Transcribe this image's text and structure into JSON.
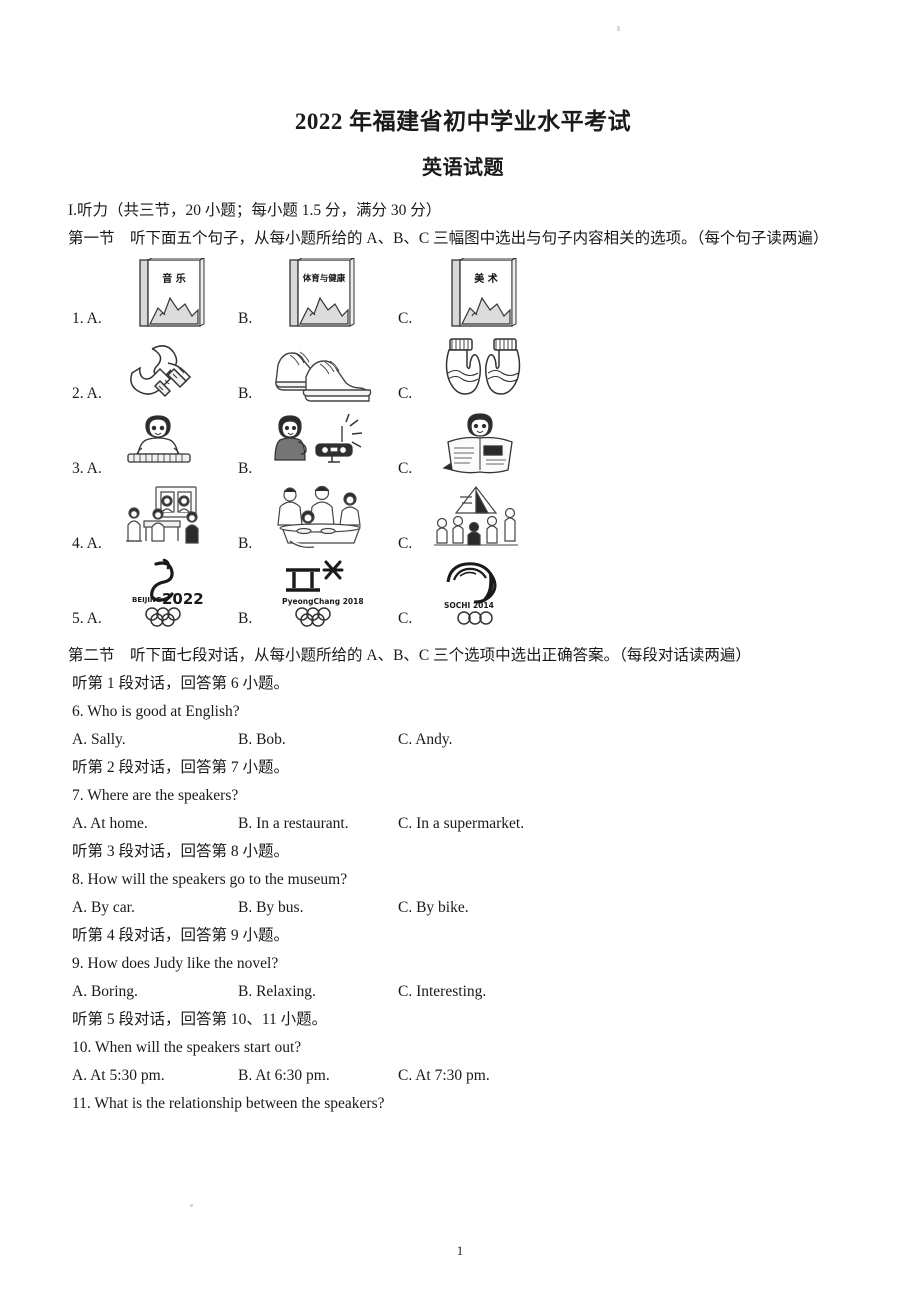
{
  "document": {
    "title": "2022 年福建省初中学业水平考试",
    "subtitle": "英语试题",
    "page_number": "1"
  },
  "part_one": {
    "heading": "I.听力（共三节，20 小题；每小题 1.5 分，满分 30 分）",
    "section_one_heading": "第一节　听下面五个句子，从每小题所给的 A、B、C 三幅图中选出与句子内容相关的选项。（每个句子读两遍）",
    "picture_questions": [
      {
        "number": "1.",
        "labels": [
          "A.",
          "B.",
          "C."
        ],
        "images": [
          {
            "name": "music-textbook-image",
            "caption": "音 乐"
          },
          {
            "name": "pe-health-textbook-image",
            "caption": "体育与健康"
          },
          {
            "name": "art-textbook-image",
            "caption": "美 术"
          }
        ]
      },
      {
        "number": "2.",
        "labels": [
          "A.",
          "B.",
          "C."
        ],
        "images": [
          {
            "name": "socks-image",
            "caption": ""
          },
          {
            "name": "sneakers-image",
            "caption": ""
          },
          {
            "name": "mittens-image",
            "caption": ""
          }
        ]
      },
      {
        "number": "3.",
        "labels": [
          "A.",
          "B.",
          "C."
        ],
        "images": [
          {
            "name": "boy-playing-keyboard-image",
            "caption": ""
          },
          {
            "name": "boy-listening-to-radio-image",
            "caption": ""
          },
          {
            "name": "boy-reading-newspaper-image",
            "caption": ""
          }
        ]
      },
      {
        "number": "4.",
        "labels": [
          "A.",
          "B.",
          "C."
        ],
        "images": [
          {
            "name": "family-at-home-image",
            "caption": ""
          },
          {
            "name": "family-dining-image",
            "caption": ""
          },
          {
            "name": "camping-image",
            "caption": ""
          }
        ]
      },
      {
        "number": "5.",
        "labels": [
          "A.",
          "B.",
          "C."
        ],
        "images": [
          {
            "name": "beijing-2022-emblem-image",
            "caption": "BEIJING 2022"
          },
          {
            "name": "pyeongchang-2018-emblem-image",
            "caption": "PyeongChang 2018"
          },
          {
            "name": "sochi-2014-emblem-image",
            "caption": "SOCHI 2014"
          }
        ]
      }
    ]
  },
  "part_two": {
    "section_two_heading": "第二节　听下面七段对话，从每小题所给的 A、B、C 三个选项中选出正确答案。（每段对话读两遍）",
    "items": [
      {
        "lead": "听第 1 段对话，回答第 6 小题。",
        "question": "6. Who is good at English?",
        "options": [
          "A. Sally.",
          "B. Bob.",
          "C. Andy."
        ]
      },
      {
        "lead": "听第 2 段对话，回答第 7 小题。",
        "question": "7. Where are the speakers?",
        "options": [
          "A. At home.",
          "B. In a restaurant.",
          "C. In a supermarket."
        ]
      },
      {
        "lead": "听第 3 段对话，回答第 8 小题。",
        "question": "8. How will the speakers go to the museum?",
        "options": [
          "A. By car.",
          "B. By bus.",
          "C. By bike."
        ]
      },
      {
        "lead": "听第 4 段对话，回答第 9 小题。",
        "question": "9. How does Judy like the novel?",
        "options": [
          "A. Boring.",
          "B. Relaxing.",
          "C. Interesting."
        ]
      },
      {
        "lead": "听第 5 段对话，回答第 10、11 小题。",
        "question": "10. When will the speakers start out?",
        "options": [
          "A. At 5:30 pm.",
          "B. At 6:30 pm.",
          "C. At 7:30 pm."
        ]
      }
    ],
    "trailing_question": "11. What is the relationship between the speakers?"
  }
}
